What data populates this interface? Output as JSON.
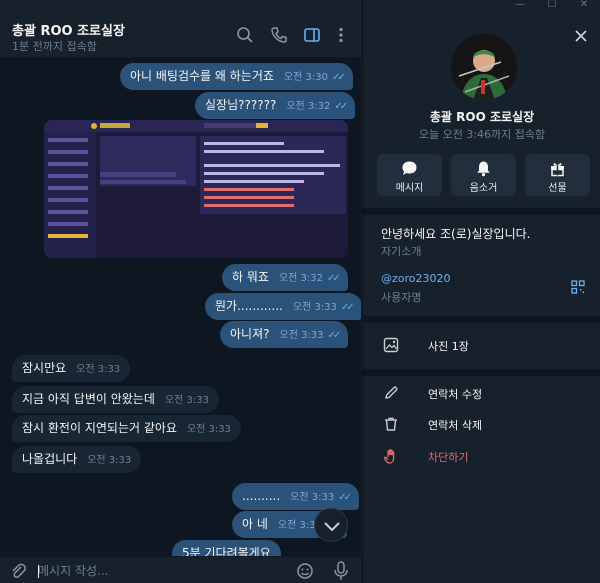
{
  "window": {
    "controls": [
      "—",
      "☐",
      "✕"
    ]
  },
  "chat": {
    "title": "총괄 ROO 조로실장",
    "status": "1분 전까지 접속함",
    "messages": [
      {
        "dir": "out",
        "text": "아니 배팅검수를 왜 하는거죠",
        "time": "오전 3:30",
        "read": true
      },
      {
        "dir": "out",
        "text": "실장님??????",
        "time": "오전 3:32",
        "read": true
      },
      {
        "dir": "out",
        "type": "image"
      },
      {
        "dir": "out",
        "text": "하 뭐죠",
        "time": "오전 3:32",
        "read": true
      },
      {
        "dir": "out",
        "text": "뭔가............",
        "time": "오전 3:33",
        "read": true
      },
      {
        "dir": "out",
        "text": "아니져?",
        "time": "오전 3:33",
        "read": true
      },
      {
        "dir": "in",
        "text": "잠시만요",
        "time": "오전 3:33"
      },
      {
        "dir": "in",
        "text": "지금 아직 답변이 안왔는데",
        "time": "오전 3:33"
      },
      {
        "dir": "in",
        "text": "잠시 환전이 지연되는거 같아요",
        "time": "오전 3:33"
      },
      {
        "dir": "in",
        "text": "나올겁니다",
        "time": "오전 3:33"
      },
      {
        "dir": "out",
        "text": "..........",
        "time": "오전 3:33",
        "read": true
      },
      {
        "dir": "out",
        "text": "아 네",
        "time": "오전 3:33",
        "read": true
      },
      {
        "dir": "out",
        "text": "5분 기다려볼게요",
        "time": "",
        "read": false
      }
    ],
    "composer_placeholder": "메시지 작성..."
  },
  "profile": {
    "name": "총괄 ROO 조로실장",
    "status": "오늘 오전 3:46까지 접속함",
    "actions": [
      {
        "label": "메시지",
        "icon": "message-icon"
      },
      {
        "label": "음소거",
        "icon": "bell-icon"
      },
      {
        "label": "선물",
        "icon": "gift-icon"
      }
    ],
    "bio": "안녕하세요 조(로)실장입니다.",
    "bio_label": "자기소개",
    "username": "@zoro23020",
    "username_label": "사용자명",
    "media": "사진 1장",
    "edit_contact": "연락처 수정",
    "delete_contact": "연락처 삭제",
    "block": "차단하기"
  },
  "colors": {
    "accent": "#5fb3f2",
    "outgoing": "#2b5278",
    "incoming": "#182533",
    "danger": "#e06c6c"
  }
}
